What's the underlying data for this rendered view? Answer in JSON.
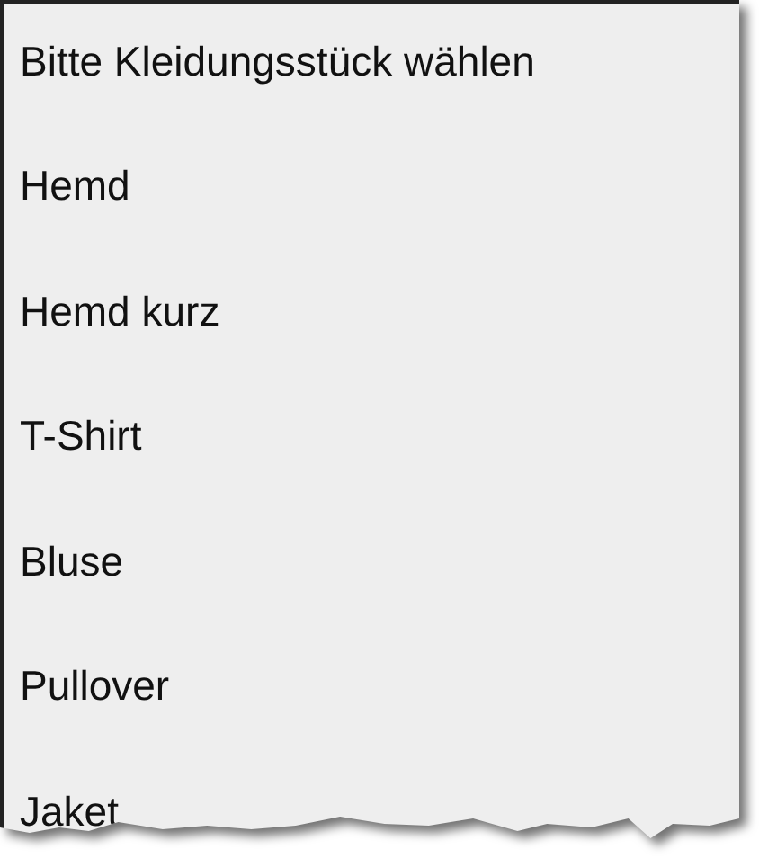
{
  "dropdown": {
    "prompt": "Bitte Kleidungsstück wählen",
    "options": [
      "Hemd",
      "Hemd kurz",
      "T-Shirt",
      "Bluse",
      "Pullover",
      "Jaket"
    ]
  }
}
